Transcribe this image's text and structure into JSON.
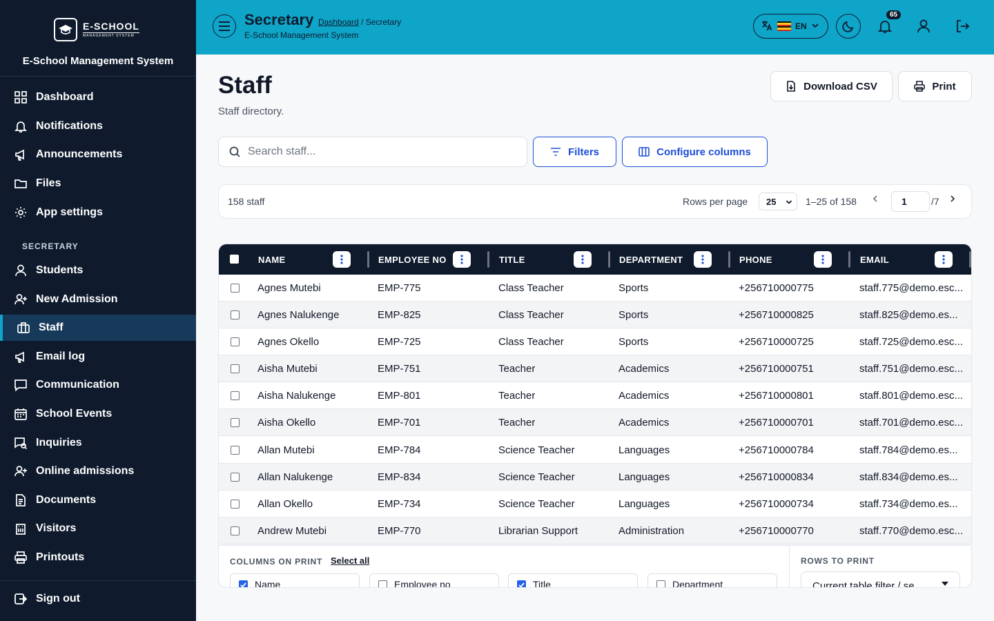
{
  "sidebar": {
    "logo": {
      "word": "E-SCHOOL",
      "tag": "MANAGEMENT SYSTEM"
    },
    "app_title": "E-School Management System",
    "items_top": [
      {
        "label": "Dashboard",
        "icon": "grid-icon"
      },
      {
        "label": "Notifications",
        "icon": "bell-icon"
      },
      {
        "label": "Announcements",
        "icon": "megaphone-icon"
      },
      {
        "label": "Files",
        "icon": "folder-icon"
      },
      {
        "label": "App settings",
        "icon": "gear-icon"
      }
    ],
    "section_label": "SECRETARY",
    "items_section": [
      {
        "label": "Students",
        "icon": "user-icon"
      },
      {
        "label": "New Admission",
        "icon": "user-plus-icon"
      },
      {
        "label": "Staff",
        "icon": "briefcase-icon",
        "active": true
      },
      {
        "label": "Email log",
        "icon": "megaphone-icon"
      },
      {
        "label": "Communication",
        "icon": "chat-icon"
      },
      {
        "label": "School Events",
        "icon": "calendar-icon"
      },
      {
        "label": "Inquiries",
        "icon": "inquiry-icon"
      },
      {
        "label": "Online admissions",
        "icon": "user-plus-icon"
      },
      {
        "label": "Documents",
        "icon": "document-icon"
      },
      {
        "label": "Visitors",
        "icon": "building-icon"
      },
      {
        "label": "Printouts",
        "icon": "printer-icon"
      }
    ],
    "sign_out": "Sign out"
  },
  "topbar": {
    "title": "Secretary",
    "breadcrumb_link": "Dashboard",
    "breadcrumb_rest": " / Secretary",
    "subtitle": "E-School Management System",
    "language": "EN",
    "notification_count": "65",
    "colors": {
      "bar": "#0ea5c9",
      "ink": "#0f1b2d"
    }
  },
  "page": {
    "title": "Staff",
    "description": "Staff directory.",
    "download_csv": "Download CSV",
    "print": "Print",
    "search_placeholder": "Search staff...",
    "filters": "Filters",
    "configure_columns": "Configure columns"
  },
  "pager": {
    "count": "158 staff",
    "rows_per_page_label": "Rows per page",
    "rows_per_page": "25",
    "range": "1–25 of 158",
    "page": "1",
    "total_pages": "/7"
  },
  "table": {
    "columns": [
      "NAME",
      "EMPLOYEE NO",
      "TITLE",
      "DEPARTMENT",
      "PHONE",
      "EMAIL"
    ],
    "rows": [
      [
        "Agnes Mutebi",
        "EMP-775",
        "Class Teacher",
        "Sports",
        "+256710000775",
        "staff.775@demo.esc..."
      ],
      [
        "Agnes Nalukenge",
        "EMP-825",
        "Class Teacher",
        "Sports",
        "+256710000825",
        "staff.825@demo.es..."
      ],
      [
        "Agnes Okello",
        "EMP-725",
        "Class Teacher",
        "Sports",
        "+256710000725",
        "staff.725@demo.esc..."
      ],
      [
        "Aisha Mutebi",
        "EMP-751",
        "Teacher",
        "Academics",
        "+256710000751",
        "staff.751@demo.esc..."
      ],
      [
        "Aisha Nalukenge",
        "EMP-801",
        "Teacher",
        "Academics",
        "+256710000801",
        "staff.801@demo.esc..."
      ],
      [
        "Aisha Okello",
        "EMP-701",
        "Teacher",
        "Academics",
        "+256710000701",
        "staff.701@demo.esc..."
      ],
      [
        "Allan Mutebi",
        "EMP-784",
        "Science Teacher",
        "Languages",
        "+256710000784",
        "staff.784@demo.es..."
      ],
      [
        "Allan Nalukenge",
        "EMP-834",
        "Science Teacher",
        "Languages",
        "+256710000834",
        "staff.834@demo.es..."
      ],
      [
        "Allan Okello",
        "EMP-734",
        "Science Teacher",
        "Languages",
        "+256710000734",
        "staff.734@demo.es..."
      ],
      [
        "Andrew Mutebi",
        "EMP-770",
        "Librarian Support",
        "Administration",
        "+256710000770",
        "staff.770@demo.esc..."
      ]
    ]
  },
  "print_panel": {
    "columns_label": "COLUMNS ON PRINT",
    "select_all": "Select all",
    "columns": [
      {
        "label": "Name",
        "checked": true
      },
      {
        "label": "Employee no",
        "checked": false
      },
      {
        "label": "Title",
        "checked": true
      },
      {
        "label": "Department",
        "checked": false
      }
    ],
    "rows_label": "ROWS TO PRINT",
    "rows_value": "Current table filter / se"
  }
}
